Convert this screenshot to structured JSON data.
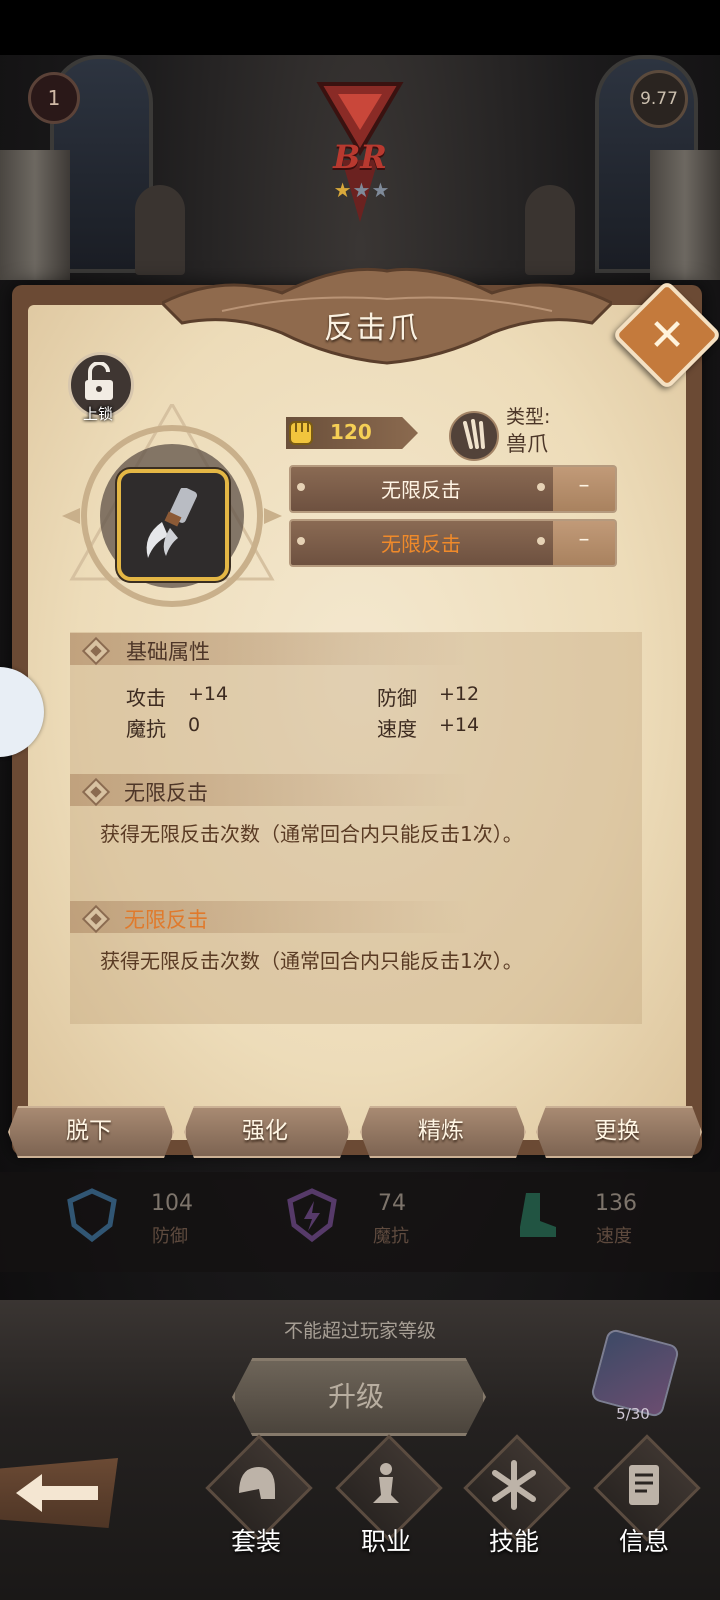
{
  "hud": {
    "lives": "1",
    "power_level": "9.77",
    "rank": "BR"
  },
  "panel": {
    "title": "反击爪",
    "lock_label": "上锁",
    "power_value": "120",
    "type_label": "类型:",
    "type_value": "兽爪",
    "gems": [
      {
        "label": "无限反击",
        "action": "–",
        "color": "#fff4e4"
      },
      {
        "label": "无限反击",
        "action": "–",
        "color": "#f08a2a"
      }
    ]
  },
  "base_stats": {
    "title": "基础属性",
    "items": [
      {
        "name": "攻击",
        "value": "+14"
      },
      {
        "name": "防御",
        "value": "+12"
      },
      {
        "name": "魔抗",
        "value": "0"
      },
      {
        "name": "速度",
        "value": "+14"
      }
    ]
  },
  "effects": [
    {
      "title": "无限反击",
      "title_color": "#4e3628",
      "desc": "获得无限反击次数（通常回合内只能反击1次）。"
    },
    {
      "title": "无限反击",
      "title_color": "#e07a2c",
      "desc": "获得无限反击次数（通常回合内只能反击1次）。"
    }
  ],
  "actions": [
    "脱下",
    "强化",
    "精炼",
    "更换"
  ],
  "attributes": [
    {
      "value": "104",
      "label": "防御",
      "icon": "shield-icon"
    },
    {
      "value": "74",
      "label": "魔抗",
      "icon": "lightning-icon"
    },
    {
      "value": "136",
      "label": "速度",
      "icon": "boot-icon"
    }
  ],
  "level_note": "不能超过玩家等级",
  "upgrade_label": "升级",
  "shard_count": "5/30",
  "nav": [
    {
      "label": "套装",
      "icon": "helmet-icon"
    },
    {
      "label": "职业",
      "icon": "chess-piece-icon"
    },
    {
      "label": "技能",
      "icon": "skill-rune-icon"
    },
    {
      "label": "信息",
      "icon": "document-icon"
    }
  ]
}
